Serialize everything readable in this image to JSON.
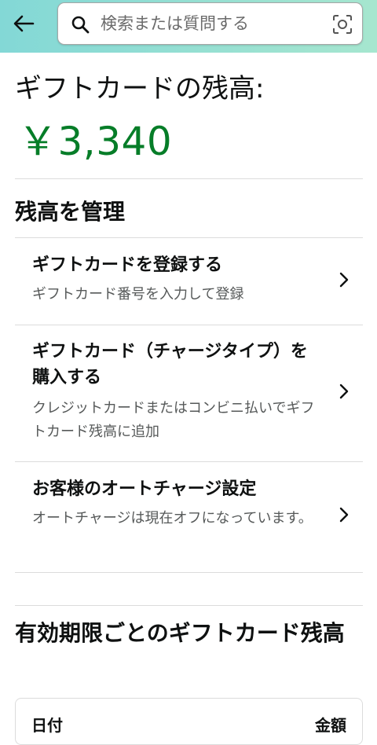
{
  "header": {
    "search": {
      "placeholder": "検索または質問する",
      "value": ""
    },
    "icons": {
      "back": "arrow-left-icon",
      "search": "search-icon",
      "camera": "camera-scan-icon"
    },
    "colors": {
      "topbar_start": "#83d8d6",
      "topbar_end": "#a6e6cf"
    }
  },
  "balance": {
    "label": "ギフトカードの残高:",
    "amount": "￥3,340",
    "amount_color": "#067d28"
  },
  "manage": {
    "title": "残高を管理",
    "items": [
      {
        "title": "ギフトカードを登録する",
        "subtitle": "ギフトカード番号を入力して登録"
      },
      {
        "title": "ギフトカード（チャージタイプ）を購入する",
        "subtitle": "クレジットカードまたはコンビニ払いでギフトカード残高に追加"
      },
      {
        "title": "お客様のオートチャージ設定",
        "subtitle": "オートチャージは現在オフになっています。"
      }
    ]
  },
  "expiry": {
    "title": "有効期限ごとのギフトカード残高",
    "columns": [
      "日付",
      "金額"
    ]
  }
}
